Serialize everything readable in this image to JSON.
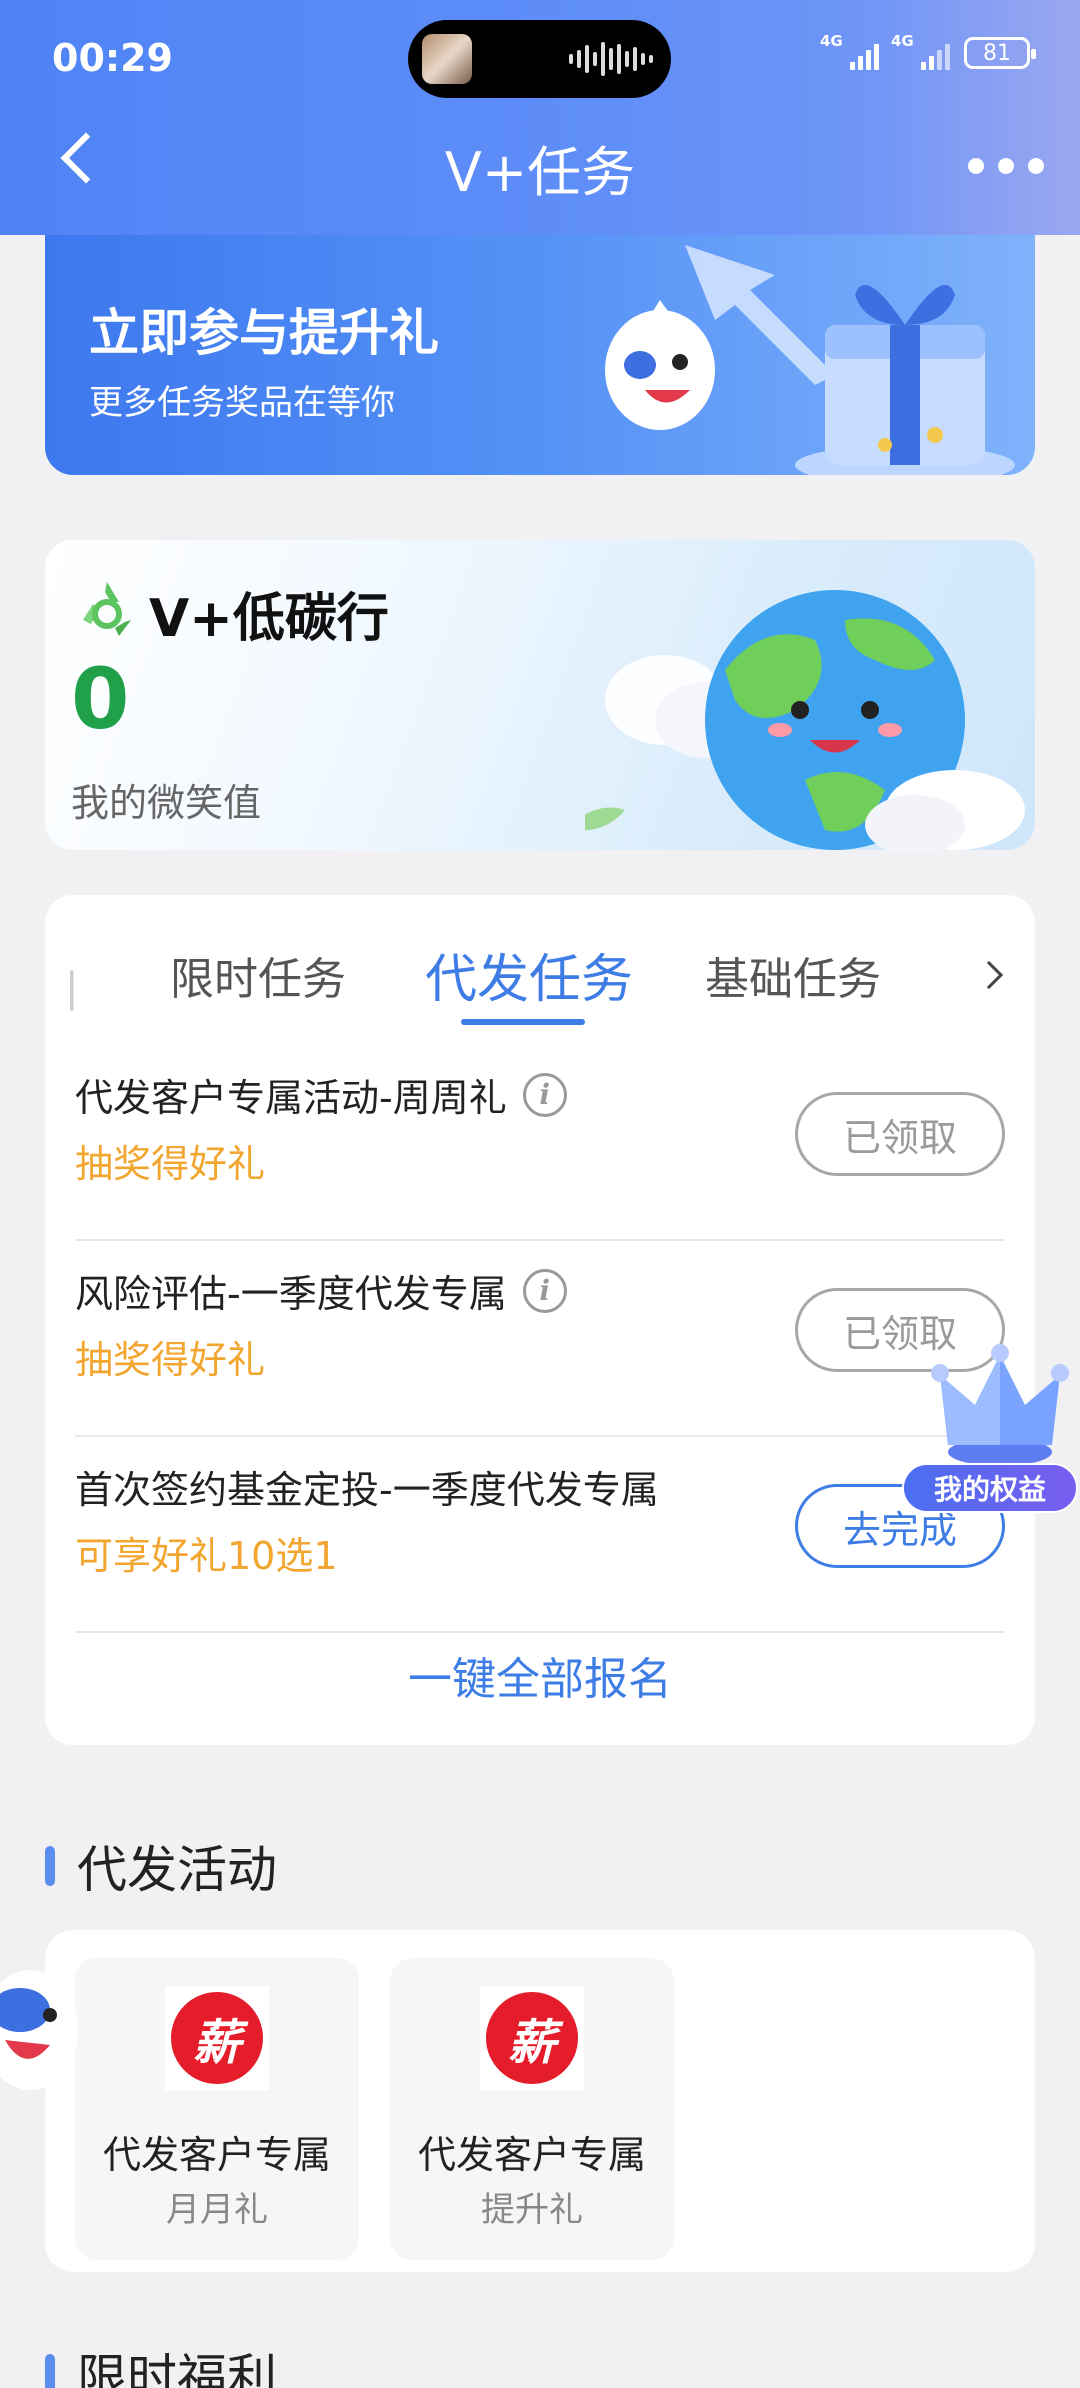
{
  "status_bar": {
    "time": "00:29",
    "signal_1": "4G",
    "signal_2": "4G",
    "battery": "81"
  },
  "nav": {
    "title": "V+任务",
    "back_icon": "chevron-left-icon",
    "more_icon": "more-dots-icon"
  },
  "banner": {
    "title": "立即参与提升礼",
    "subtitle": "更多任务奖品在等你"
  },
  "carbon": {
    "title": "V+低碳行",
    "value": "0",
    "label": "我的微笑值",
    "icon": "recycle-icon"
  },
  "tasks": {
    "tabs": [
      {
        "label": "限时任务",
        "active": false
      },
      {
        "label": "代发任务",
        "active": true
      },
      {
        "label": "基础任务",
        "active": false
      }
    ],
    "items": [
      {
        "title": "代发客户专属活动-周周礼",
        "has_info": true,
        "subtitle": "抽奖得好礼",
        "button": "已领取",
        "button_state": "done"
      },
      {
        "title": "风险评估-一季度代发专属",
        "has_info": true,
        "subtitle": "抽奖得好礼",
        "button": "已领取",
        "button_state": "done"
      },
      {
        "title": "首次签约基金定投-一季度代发专属",
        "has_info": false,
        "subtitle": "可享好礼10选1",
        "button": "去完成",
        "button_state": "todo"
      }
    ],
    "enroll_all": "一键全部报名"
  },
  "float_badge": {
    "label": "我的权益"
  },
  "activities": {
    "section_title": "代发活动",
    "items": [
      {
        "logo_text": "薪",
        "name": "代发客户专属",
        "sub": "月月礼"
      },
      {
        "logo_text": "薪",
        "name": "代发客户专属",
        "sub": "提升礼"
      }
    ]
  },
  "benefits": {
    "section_title": "限时福利"
  },
  "colors": {
    "primary": "#3f7de6",
    "accent_orange": "#f2a52f",
    "green_value": "#21a04a",
    "logo_red": "#e51d2a"
  }
}
